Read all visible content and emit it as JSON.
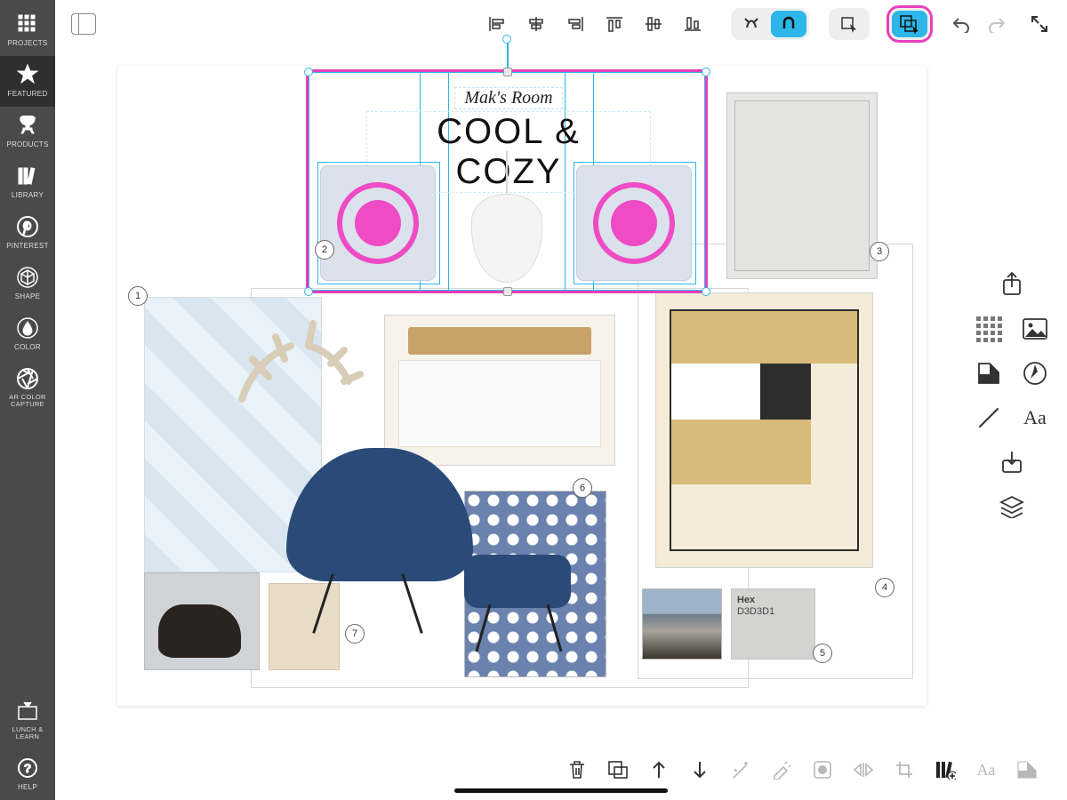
{
  "left_rail": {
    "items": [
      {
        "label": "PROJECTS"
      },
      {
        "label": "FEATURED"
      },
      {
        "label": "PRODUCTS"
      },
      {
        "label": "LIBRARY"
      },
      {
        "label": "PINTEREST"
      },
      {
        "label": "SHAPE"
      },
      {
        "label": "COLOR"
      },
      {
        "label": "AR COLOR CAPTURE"
      }
    ],
    "bottom": [
      {
        "label": "LUNCH & LEARN"
      },
      {
        "label": "HELP"
      }
    ]
  },
  "topbar": {
    "align": [
      "align-left",
      "align-hcenter",
      "align-right",
      "align-top",
      "align-vcenter",
      "align-bottom"
    ],
    "snap": {
      "free": "freeform",
      "magnet": "snap"
    },
    "group": {
      "select": "select-behind",
      "group": "group-select"
    }
  },
  "canvas": {
    "subtitle": "Mak's Room",
    "title": "COOL & COZY",
    "swatch": {
      "label": "Hex",
      "value": "D3D3D1"
    },
    "tags": [
      "1",
      "2",
      "3",
      "4",
      "5",
      "6",
      "7"
    ]
  },
  "right_panel": {
    "tools": [
      "share",
      "pattern-grid",
      "image",
      "swatch",
      "compass",
      "pencil",
      "text",
      "download",
      "layers"
    ]
  },
  "bottom_bar": {
    "tools": [
      "trash",
      "duplicate",
      "bring-forward",
      "send-backward",
      "magic-wand",
      "magic-erase",
      "mask",
      "flip-h",
      "crop",
      "add-to-library",
      "text-style",
      "color-adjust"
    ]
  }
}
